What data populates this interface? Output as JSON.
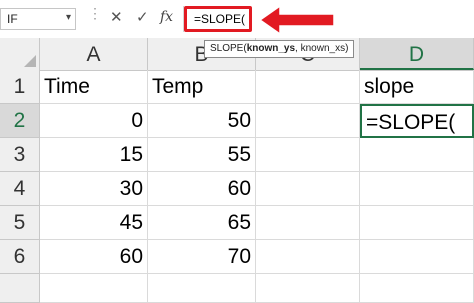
{
  "formula_bar": {
    "name_box": "IF",
    "cancel_icon": "✕",
    "enter_icon": "✓",
    "fx_label": "fx",
    "formula": "=SLOPE("
  },
  "tooltip": {
    "func": "SLOPE(",
    "arg1": "known_ys",
    "sep": ", ",
    "arg2": "known_xs",
    "close": ")"
  },
  "columns": [
    "A",
    "B",
    "C",
    "D"
  ],
  "rows": [
    "1",
    "2",
    "3",
    "4",
    "5",
    "6"
  ],
  "cells": {
    "A1": "Time",
    "B1": "Temp",
    "D1": "slope",
    "A2": "0",
    "B2": "50",
    "D2": "=SLOPE(",
    "A3": "15",
    "B3": "55",
    "A4": "30",
    "B4": "60",
    "A5": "45",
    "B5": "65",
    "A6": "60",
    "B6": "70"
  },
  "colors": {
    "highlight": "#e21a22",
    "accent": "#217346"
  }
}
